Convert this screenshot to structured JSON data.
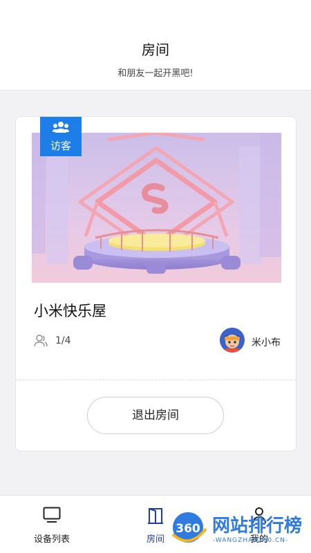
{
  "header": {
    "title": "房间",
    "subtitle": "和朋友一起开黑吧!"
  },
  "room": {
    "badge_label": "访客",
    "name": "小米快乐屋",
    "member_count": "1/4",
    "owner_name": "米小布",
    "exit_label": "退出房间"
  },
  "tabbar": {
    "items": [
      {
        "label": "设备列表",
        "icon": "monitor-icon",
        "active": false
      },
      {
        "label": "房间",
        "icon": "door-icon",
        "active": true
      },
      {
        "label": "我的",
        "icon": "person-icon",
        "active": false
      }
    ],
    "active_color": "#1f3fa0"
  },
  "watermark": {
    "number": "360",
    "text": "网站排行榜",
    "sub": "-WANGZHAN360.CN-"
  },
  "colors": {
    "badge": "#1e7ee8",
    "background": "#f2f2f4"
  }
}
